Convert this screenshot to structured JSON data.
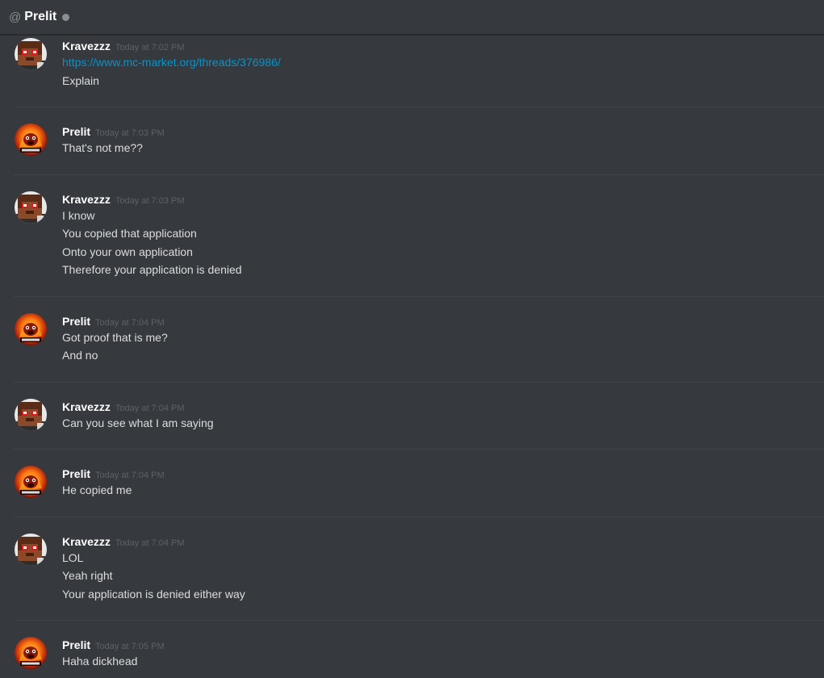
{
  "header": {
    "at_symbol": "@",
    "title": "Prelit",
    "status": "offline"
  },
  "colors": {
    "background": "#36393e",
    "link": "#0096cf",
    "username": "#ffffff",
    "timestamp": "#5e6167",
    "text": "#dcddde"
  },
  "messages": [
    {
      "author": "Kravezzz",
      "avatar": "minecraft-skin-avatar",
      "timestamp": "Today at 7:02 PM",
      "lines": [
        "https://www.mc-market.org/threads/376986/",
        "Explain"
      ],
      "link_line": 0
    },
    {
      "author": "Prelit",
      "avatar": "fire-get-hyped-avatar",
      "timestamp": "Today at 7:03 PM",
      "lines": [
        "That's not me??"
      ]
    },
    {
      "author": "Kravezzz",
      "avatar": "minecraft-skin-avatar",
      "timestamp": "Today at 7:03 PM",
      "lines": [
        "I know",
        "You copied that application",
        "Onto your own application",
        "Therefore your application is denied"
      ]
    },
    {
      "author": "Prelit",
      "avatar": "fire-get-hyped-avatar",
      "timestamp": "Today at 7:04 PM",
      "lines": [
        "Got proof that is me?",
        "And no"
      ]
    },
    {
      "author": "Kravezzz",
      "avatar": "minecraft-skin-avatar",
      "timestamp": "Today at 7:04 PM",
      "lines": [
        "Can you see what I am saying"
      ]
    },
    {
      "author": "Prelit",
      "avatar": "fire-get-hyped-avatar",
      "timestamp": "Today at 7:04 PM",
      "lines": [
        "He copied me"
      ]
    },
    {
      "author": "Kravezzz",
      "avatar": "minecraft-skin-avatar",
      "timestamp": "Today at 7:04 PM",
      "lines": [
        "LOL",
        "Yeah right",
        "Your application is denied either way"
      ]
    },
    {
      "author": "Prelit",
      "avatar": "fire-get-hyped-avatar",
      "timestamp": "Today at 7:05 PM",
      "lines": [
        "Haha dickhead"
      ]
    }
  ]
}
